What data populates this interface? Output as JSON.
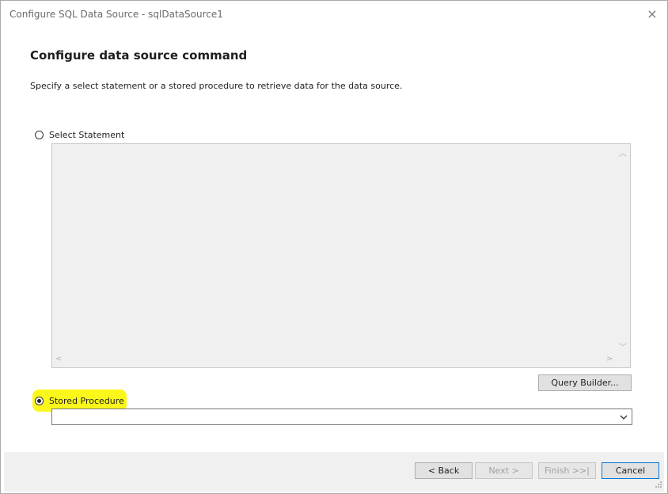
{
  "window": {
    "title": "Configure SQL Data Source - sqlDataSource1",
    "close_icon": "×"
  },
  "page": {
    "heading": "Configure data source command",
    "description": "Specify a select statement or a stored procedure to retrieve data for the data source."
  },
  "options": {
    "select_statement": {
      "label": "Select Statement",
      "checked": false,
      "text": ""
    },
    "stored_procedure": {
      "label": "Stored Procedure",
      "checked": true,
      "value": ""
    }
  },
  "buttons": {
    "query_builder": "Query Builder...",
    "back": "< Back",
    "next": "Next >",
    "finish": "Finish >>|",
    "cancel": "Cancel"
  },
  "colors": {
    "highlight": "#fbf71a",
    "default_button_border": "#0078d7"
  }
}
